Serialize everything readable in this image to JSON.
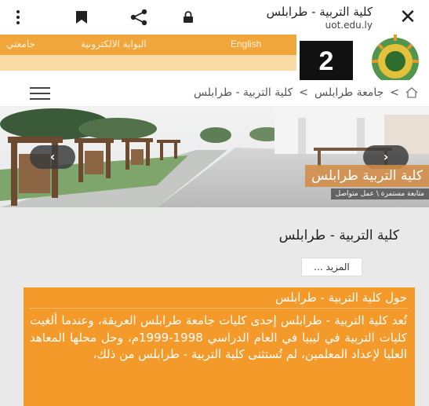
{
  "browser": {
    "page_title": "كلية التربية - طرابلس",
    "host": "uot.edu.ly",
    "close_glyph": "✕",
    "icons": [
      "more-vert-icon",
      "bookmark-icon",
      "share-icon",
      "lock-icon",
      "close-icon"
    ]
  },
  "header": {
    "links": {
      "university": "جامعتي",
      "portal": "البوابة الالكترونية",
      "english": "English"
    },
    "badge_number": "2",
    "accent_color": "#f0a63a"
  },
  "breadcrumb": {
    "items": [
      "جامعة طرابلس",
      "كلية التربية - طرابلس"
    ],
    "separator": ">"
  },
  "slider": {
    "caption_title": "كلية التربية طرابلس",
    "caption_sub": "متابعة مستمرة \\ عمل متواصل",
    "prev_glyph": "‹",
    "next_glyph": "›"
  },
  "main": {
    "heading": "كلية التربية - طرابلس",
    "more_label": "المزيد ...",
    "about_title": "حول كلية التربية - طرابلس",
    "about_text": "تُعد كلية التربية - طرابلس إحدى كليات جامعة طرابلس العريقة، وعندما ألغيت كليات التربية في ليبيا في العام الدراسي 1998-1999م، وحل محلها المعاهد العليا لإعداد المعلمين، لم تُستثنى كلية التربية - طرابلس من ذلك،",
    "about_bg": "#f39a2a"
  }
}
